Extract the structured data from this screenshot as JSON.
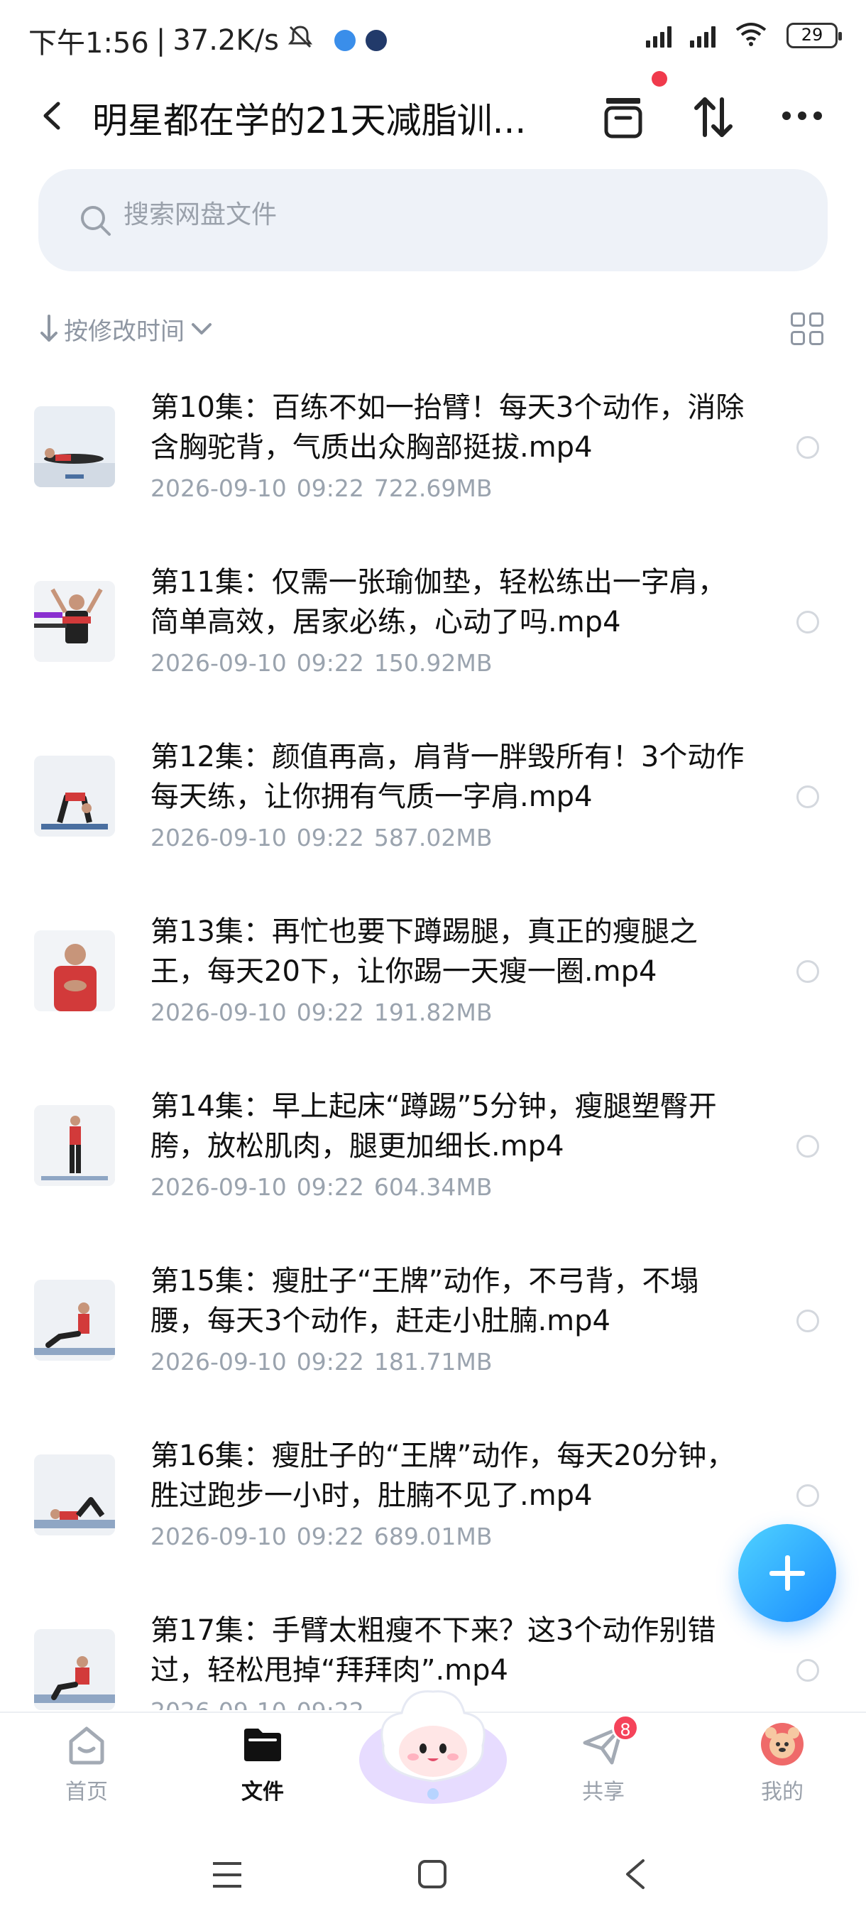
{
  "status_bar": {
    "time": "下午1:56",
    "speed": "37.2K/s",
    "battery": "29"
  },
  "header": {
    "title": "明星都在学的21天减脂训..."
  },
  "search": {
    "placeholder": "搜索网盘文件"
  },
  "sort": {
    "label": "按修改时间"
  },
  "files": [
    {
      "name": "第10集：百练不如一抬臂！每天3个动作，消除含胸驼背，气质出众胸部挺拔.mp4",
      "date": "2026-09-10",
      "time": "09:22",
      "size": "722.69MB"
    },
    {
      "name": "第11集：仅需一张瑜伽垫，轻松练出一字肩，简单高效，居家必练，心动了吗.mp4",
      "date": "2026-09-10",
      "time": "09:22",
      "size": "150.92MB"
    },
    {
      "name": "第12集：颜值再高，肩背一胖毁所有！3个动作每天练，让你拥有气质一字肩.mp4",
      "date": "2026-09-10",
      "time": "09:22",
      "size": "587.02MB"
    },
    {
      "name": "第13集：再忙也要下蹲踢腿，真正的瘦腿之王，每天20下，让你踢一天瘦一圈.mp4",
      "date": "2026-09-10",
      "time": "09:22",
      "size": "191.82MB"
    },
    {
      "name": "第14集：早上起床“蹲踢”5分钟，瘦腿塑臀开胯，放松肌肉，腿更加细长.mp4",
      "date": "2026-09-10",
      "time": "09:22",
      "size": "604.34MB"
    },
    {
      "name": "第15集：瘦肚子“王牌”动作，不弓背，不塌腰，每天3个动作，赶走小肚腩.mp4",
      "date": "2026-09-10",
      "time": "09:22",
      "size": "181.71MB"
    },
    {
      "name": "第16集：瘦肚子的“王牌”动作，每天20分钟，胜过跑步一小时，肚腩不见了.mp4",
      "date": "2026-09-10",
      "time": "09:22",
      "size": "689.01MB"
    },
    {
      "name": "第17集：手臂太粗瘦不下来？这3个动作别错过，轻松甩掉“拜拜肉”.mp4",
      "date": "2026-09-10",
      "time": "09:22",
      "size": ""
    }
  ],
  "tabs": [
    {
      "label": "首页",
      "icon": "home-icon"
    },
    {
      "label": "文件",
      "icon": "folder-icon"
    },
    {
      "label": "共享",
      "icon": "share-icon",
      "badge": "8"
    },
    {
      "label": "我的",
      "icon": "avatar-icon"
    }
  ],
  "colors": {
    "accent": "#1a8cff",
    "badge": "#f5435a",
    "muted": "#9aa1ab"
  }
}
